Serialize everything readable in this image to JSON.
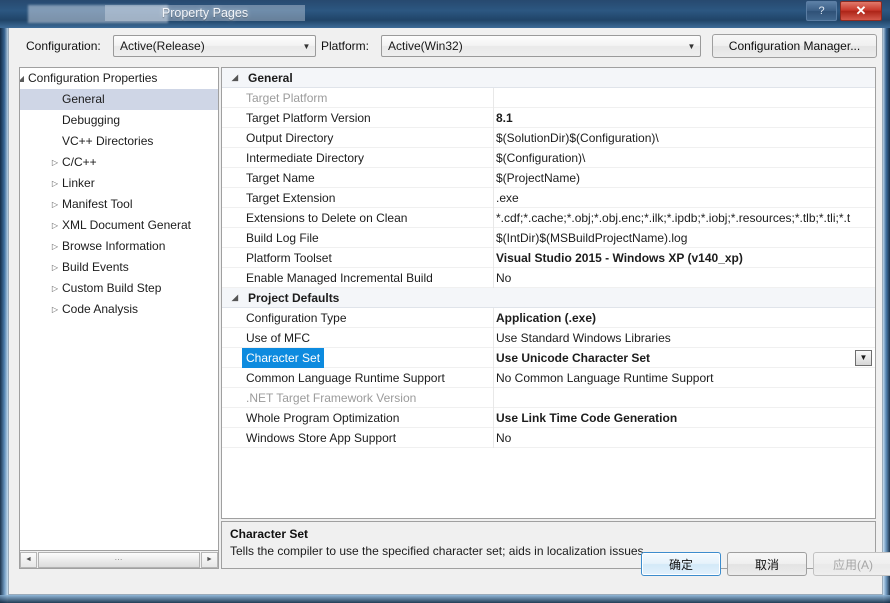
{
  "window": {
    "title": "Property Pages",
    "help_button": "?",
    "close_button": "✕"
  },
  "toolbar": {
    "configuration_label": "Configuration:",
    "configuration_value": "Active(Release)",
    "platform_label": "Platform:",
    "platform_value": "Active(Win32)",
    "configuration_manager_label": "Configuration Manager...",
    "dropdown_glyph": "▼"
  },
  "tree": {
    "items": [
      {
        "label": "Configuration Properties",
        "indent": 8,
        "twisty": "◢",
        "selected": false
      },
      {
        "label": "General",
        "indent": 42,
        "twisty": "",
        "selected": true
      },
      {
        "label": "Debugging",
        "indent": 42,
        "twisty": "",
        "selected": false
      },
      {
        "label": "VC++ Directories",
        "indent": 42,
        "twisty": "",
        "selected": false
      },
      {
        "label": "C/C++",
        "indent": 42,
        "twisty": "▷",
        "selected": false
      },
      {
        "label": "Linker",
        "indent": 42,
        "twisty": "▷",
        "selected": false
      },
      {
        "label": "Manifest Tool",
        "indent": 42,
        "twisty": "▷",
        "selected": false
      },
      {
        "label": "XML Document Generat",
        "indent": 42,
        "twisty": "▷",
        "selected": false
      },
      {
        "label": "Browse Information",
        "indent": 42,
        "twisty": "▷",
        "selected": false
      },
      {
        "label": "Build Events",
        "indent": 42,
        "twisty": "▷",
        "selected": false
      },
      {
        "label": "Custom Build Step",
        "indent": 42,
        "twisty": "▷",
        "selected": false
      },
      {
        "label": "Code Analysis",
        "indent": 42,
        "twisty": "▷",
        "selected": false
      }
    ],
    "scrollbar": {
      "left_arrow": "◄",
      "right_arrow": "►",
      "thumb_grip": "⋯"
    }
  },
  "grid": {
    "rows": [
      {
        "kind": "category",
        "name": "General",
        "value": "",
        "twisty": "◢",
        "bold_value": false,
        "dim": false,
        "selected": false,
        "dropdown": false
      },
      {
        "kind": "property",
        "name": "Target Platform",
        "value": "",
        "twisty": "",
        "bold_value": false,
        "dim": true,
        "selected": false,
        "dropdown": false
      },
      {
        "kind": "property",
        "name": "Target Platform Version",
        "value": "8.1",
        "twisty": "",
        "bold_value": true,
        "dim": false,
        "selected": false,
        "dropdown": false
      },
      {
        "kind": "property",
        "name": "Output Directory",
        "value": "$(SolutionDir)$(Configuration)\\",
        "twisty": "",
        "bold_value": false,
        "dim": false,
        "selected": false,
        "dropdown": false
      },
      {
        "kind": "property",
        "name": "Intermediate Directory",
        "value": "$(Configuration)\\",
        "twisty": "",
        "bold_value": false,
        "dim": false,
        "selected": false,
        "dropdown": false
      },
      {
        "kind": "property",
        "name": "Target Name",
        "value": "$(ProjectName)",
        "twisty": "",
        "bold_value": false,
        "dim": false,
        "selected": false,
        "dropdown": false
      },
      {
        "kind": "property",
        "name": "Target Extension",
        "value": ".exe",
        "twisty": "",
        "bold_value": false,
        "dim": false,
        "selected": false,
        "dropdown": false
      },
      {
        "kind": "property",
        "name": "Extensions to Delete on Clean",
        "value": "*.cdf;*.cache;*.obj;*.obj.enc;*.ilk;*.ipdb;*.iobj;*.resources;*.tlb;*.tli;*.t",
        "twisty": "",
        "bold_value": false,
        "dim": false,
        "selected": false,
        "dropdown": false
      },
      {
        "kind": "property",
        "name": "Build Log File",
        "value": "$(IntDir)$(MSBuildProjectName).log",
        "twisty": "",
        "bold_value": false,
        "dim": false,
        "selected": false,
        "dropdown": false
      },
      {
        "kind": "property",
        "name": "Platform Toolset",
        "value": "Visual Studio 2015 - Windows XP (v140_xp)",
        "twisty": "",
        "bold_value": true,
        "dim": false,
        "selected": false,
        "dropdown": false
      },
      {
        "kind": "property",
        "name": "Enable Managed Incremental Build",
        "value": "No",
        "twisty": "",
        "bold_value": false,
        "dim": false,
        "selected": false,
        "dropdown": false
      },
      {
        "kind": "category",
        "name": "Project Defaults",
        "value": "",
        "twisty": "◢",
        "bold_value": false,
        "dim": false,
        "selected": false,
        "dropdown": false
      },
      {
        "kind": "property",
        "name": "Configuration Type",
        "value": "Application (.exe)",
        "twisty": "",
        "bold_value": true,
        "dim": false,
        "selected": false,
        "dropdown": false
      },
      {
        "kind": "property",
        "name": "Use of MFC",
        "value": "Use Standard Windows Libraries",
        "twisty": "",
        "bold_value": false,
        "dim": false,
        "selected": false,
        "dropdown": false
      },
      {
        "kind": "property",
        "name": "Character Set",
        "value": "Use Unicode Character Set",
        "twisty": "",
        "bold_value": true,
        "dim": false,
        "selected": true,
        "dropdown": true
      },
      {
        "kind": "property",
        "name": "Common Language Runtime Support",
        "value": "No Common Language Runtime Support",
        "twisty": "",
        "bold_value": false,
        "dim": false,
        "selected": false,
        "dropdown": false
      },
      {
        "kind": "property",
        "name": ".NET Target Framework Version",
        "value": "",
        "twisty": "",
        "bold_value": false,
        "dim": true,
        "selected": false,
        "dropdown": false
      },
      {
        "kind": "property",
        "name": "Whole Program Optimization",
        "value": "Use Link Time Code Generation",
        "twisty": "",
        "bold_value": true,
        "dim": false,
        "selected": false,
        "dropdown": false
      },
      {
        "kind": "property",
        "name": "Windows Store App Support",
        "value": "No",
        "twisty": "",
        "bold_value": false,
        "dim": false,
        "selected": false,
        "dropdown": false
      }
    ],
    "dropdown_glyph": "▼"
  },
  "description": {
    "title": "Character Set",
    "text": "Tells the compiler to use the specified character set; aids in localization issues."
  },
  "buttons": {
    "ok": "确定",
    "cancel": "取消",
    "apply": "应用(A)"
  },
  "colors": {
    "selection_blue": "#0d8bdf",
    "tree_selection": "#cfd6e6",
    "dialog_background": "#f0f0f0",
    "close_button_red": "#c8392c"
  }
}
